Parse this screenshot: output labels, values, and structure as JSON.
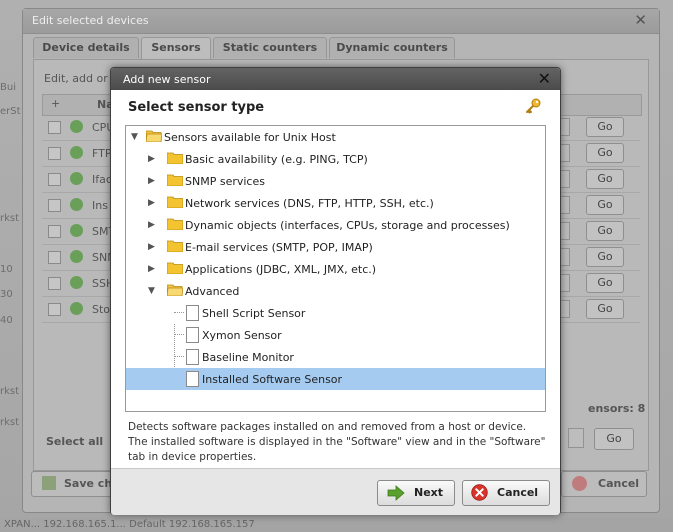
{
  "background": {
    "side_labels": [
      "Bui",
      "erSt",
      "rkst",
      "10",
      "30",
      "40",
      "rkst",
      "rkst"
    ],
    "footer_text": "XPAN...  192.168.165.1...  Default  192.168.165.157"
  },
  "outer_dialog": {
    "title": "Edit selected devices",
    "tabs": [
      "Device details",
      "Sensors",
      "Static counters",
      "Dynamic counters"
    ],
    "active_tab": "Sensors",
    "hint": "Edit, add or",
    "grid_header_plus": "+",
    "grid_header_name": "Na",
    "rows": [
      {
        "name": "CPU",
        "go": "Go"
      },
      {
        "name": "FTP",
        "go": "Go"
      },
      {
        "name": "Ifac",
        "go": "Go"
      },
      {
        "name": "Ins",
        "go": "Go"
      },
      {
        "name": "SMT",
        "go": "Go"
      },
      {
        "name": "SNM",
        "go": "Go"
      },
      {
        "name": "SSH",
        "go": "Go"
      },
      {
        "name": "Sto",
        "go": "Go"
      }
    ],
    "sensors_count": "ensors:  8",
    "select_all": "Select all",
    "go_label": "Go",
    "save_label": "Save cha",
    "cancel_label": "Cancel"
  },
  "dialog": {
    "title": "Add new sensor",
    "heading": "Select sensor type",
    "tree": {
      "root": "Sensors available for Unix Host",
      "groups": [
        "Basic availability (e.g. PING, TCP)",
        "SNMP services",
        "Network services (DNS, FTP, HTTP, SSH, etc.)",
        "Dynamic objects (interfaces, CPUs, storage and processes)",
        "E-mail services (SMTP, POP, IMAP)",
        "Applications (JDBC, XML, JMX, etc.)",
        "Advanced"
      ],
      "advanced_items": [
        "Shell Script Sensor",
        "Xymon Sensor",
        "Baseline Monitor",
        "Installed Software Sensor"
      ],
      "selected": "Installed Software Sensor"
    },
    "description": "Detects software packages installed on and removed from a host or device. The installed software is displayed in the \"Software\" view and in the \"Software\" tab in device properties.",
    "next_label": "Next",
    "cancel_label": "Cancel"
  },
  "colors": {
    "selection": "#a6cbf0",
    "folder": "#f4c430",
    "title_bar": "#555555",
    "next_arrow": "#5aa02c",
    "cancel_red": "#d9342b"
  }
}
